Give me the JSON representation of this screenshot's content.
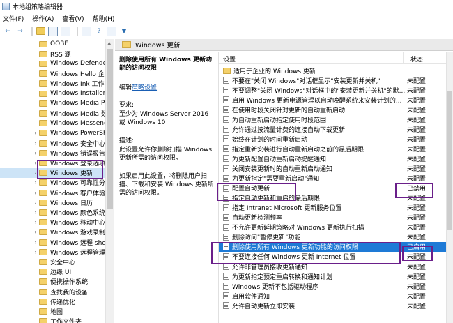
{
  "window": {
    "title": "本地组策略编辑器"
  },
  "menu": [
    "文件(F)",
    "操作(A)",
    "查看(V)",
    "帮助(H)"
  ],
  "toolbar": {
    "back": "←",
    "forward": "→",
    "help": "?",
    "filter": "▼"
  },
  "tree": {
    "items": [
      "OOBE",
      "RSS 源",
      "Windows Defender",
      "Windows Hello 企业",
      "Windows Ink 工作区",
      "Windows Installer",
      "Windows Media Pla",
      "Windows Media 数",
      "Windows Messeng",
      "Windows PowerShe",
      "Windows 安全中心",
      "Windows 错误报告",
      "Windows 登录选项",
      "Windows 更新",
      "Windows 可靠性分析",
      "Windows 客户体验改",
      "Windows 日历",
      "Windows 颜色系统",
      "Windows 移动中心",
      "Windows 游戏录制",
      "Windows 远程 shell",
      "Windows 远程管理(",
      "安全中心",
      "边缘 UI",
      "便携操作系统",
      "查找我的设备",
      "传递优化",
      "地图",
      "工作文件夹"
    ],
    "selected_index": 13,
    "expand_arrow": "›"
  },
  "header": {
    "title": "Windows 更新"
  },
  "description": {
    "title": "删除使用所有 Windows 更新功能的访问权限",
    "edit_prefix": "编辑",
    "edit_link": "策略设置",
    "req_label": "要求:",
    "req_text": "至少为 Windows Server 2016 或 Windows 10",
    "desc_label": "描述:",
    "desc_text": "此设置允许你删除扫描 Windows 更新所需的访问权限。",
    "desc_text2": "如果启用此设置，将删除用户扫描、下载和安装 Windows 更新所需的访问权限。"
  },
  "list": {
    "col_setting": "设置",
    "col_state": "状态",
    "rows": [
      {
        "name": "适用于企业的 Windows 更新",
        "state": "",
        "folder": true
      },
      {
        "name": "不要在\"关闭 Windows\"对话框显示\"安装更新并关机\"",
        "state": "未配置"
      },
      {
        "name": "不要调整\"关闭 Windows\"对话框中的\"安装更新并关机\"的默...",
        "state": "未配置"
      },
      {
        "name": "启用 Windows 更新电源管理以自动唤醒系统来安装计划的...",
        "state": "未配置"
      },
      {
        "name": "在使用时段关闭针对更新的自动重新启动",
        "state": "未配置"
      },
      {
        "name": "为自动重新启动指定使用时段范围",
        "state": "未配置"
      },
      {
        "name": "允许通过按流量计费的连接自动下载更新",
        "state": "未配置"
      },
      {
        "name": "始终在计划的时间重新启动",
        "state": "未配置"
      },
      {
        "name": "指定重新安装进行自动重新启动之前的最后期限",
        "state": "未配置"
      },
      {
        "name": "为更新配置自动重新启动提醒通知",
        "state": "未配置"
      },
      {
        "name": "关闭安装更新时的自动重新启动通知",
        "state": "未配置"
      },
      {
        "name": "为更新指定\"需要重新启动\"通知",
        "state": "未配置"
      },
      {
        "name": "配置自动更新",
        "state": "已禁用"
      },
      {
        "name": "指定自动更新和重启的最后期限",
        "state": "未配置"
      },
      {
        "name": "指定 Intranet Microsoft 更新服务位置",
        "state": "未配置"
      },
      {
        "name": "自动更新检测频率",
        "state": "未配置"
      },
      {
        "name": "不允许更新延期策略对 Windows 更新执行扫描",
        "state": "未配置"
      },
      {
        "name": "删除访问\"暂停更新\"功能",
        "state": "未配置"
      },
      {
        "name": "删除使用所有 Windows 更新功能的访问权限",
        "state": "已启用"
      },
      {
        "name": "不要连接任何 Windows 更新 Internet 位置",
        "state": "未配置"
      },
      {
        "name": "允许非管理员接收更新通知",
        "state": "未配置"
      },
      {
        "name": "为更新指定预定重启转换和通知计划",
        "state": "未配置"
      },
      {
        "name": "Windows 更新不包括驱动程序",
        "state": "未配置"
      },
      {
        "name": "启用软件通知",
        "state": "未配置"
      },
      {
        "name": "允许自动更新立即安装",
        "state": "未配置"
      }
    ],
    "selected_index": 18
  },
  "colors": {
    "selection": "#1e7ad6",
    "annotation": "#6a1f8a",
    "folder": "#f4d16a"
  }
}
